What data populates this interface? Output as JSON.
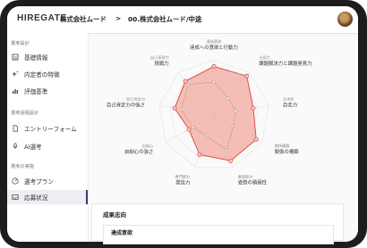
{
  "header": {
    "logo": "HIREGATE",
    "company": "株式会社ムード",
    "separator": ">",
    "page": "00.株式会社ムード/中途"
  },
  "sidebar": {
    "sections": [
      {
        "label": "選考設計",
        "items": [
          {
            "label": "基礎情報",
            "icon": "building-icon"
          },
          {
            "label": "内定者の特徴",
            "icon": "sparkle-icon"
          },
          {
            "label": "評価基準",
            "icon": "chart-icon"
          }
        ]
      },
      {
        "label": "選考過程設計",
        "items": [
          {
            "label": "エントリーフォーム",
            "icon": "document-icon"
          },
          {
            "label": "AI選考",
            "icon": "mic-icon"
          }
        ]
      },
      {
        "label": "選考の実施",
        "items": [
          {
            "label": "選考プラン",
            "icon": "dashboard-icon"
          },
          {
            "label": "応募状況",
            "icon": "inbox-icon"
          }
        ]
      }
    ],
    "active": "応募状況"
  },
  "radar": {
    "axes": [
      {
        "label": "達成への意欲と行動力",
        "small": "達成意欲"
      },
      {
        "label": "課題解決力と課題発見力",
        "small": "企画力"
      },
      {
        "label": "自走力",
        "small": "主体性"
      },
      {
        "label": "関係の構築",
        "small": "関係構築"
      },
      {
        "label": "姿勢の積極性",
        "small": "意欲能力"
      },
      {
        "label": "発信力",
        "small": "専門能力"
      },
      {
        "label": "自制心の強さ",
        "small": "自制心"
      },
      {
        "label": "自己肯定力の強さ",
        "small": "自己肯定力"
      },
      {
        "label": "挑戦力",
        "small": "自己表現力"
      }
    ],
    "series": [
      {
        "values": [
          4.4,
          4.6,
          3.6,
          4.4,
          4.4,
          3.8,
          2.6,
          3.6,
          4.0
        ]
      },
      {
        "values": [
          3.0,
          2.0,
          2.0,
          2.0,
          3.4,
          2.0,
          2.2,
          3.0,
          3.6
        ]
      }
    ],
    "max": 5,
    "colors": {
      "fill": "#f2a9a0",
      "stroke": "#d9534f",
      "inner": "#c0a97a"
    }
  },
  "card": {
    "title": "成果志向",
    "subtitle": "達成意欲"
  }
}
